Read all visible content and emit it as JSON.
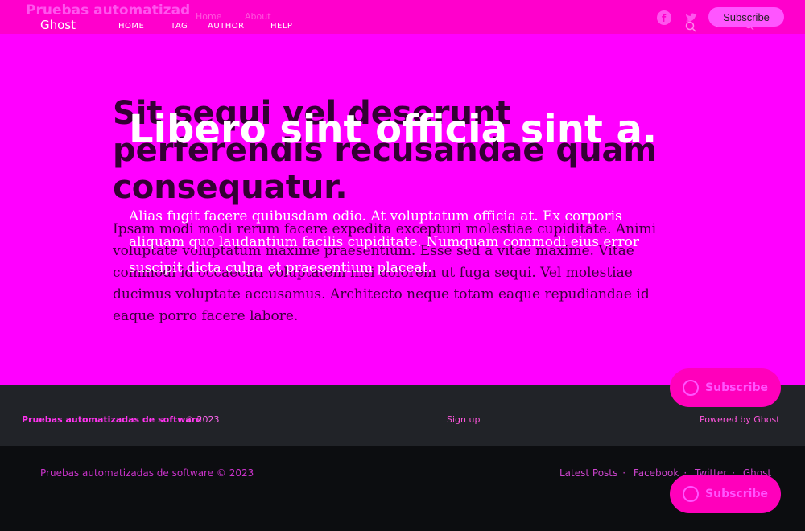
{
  "header": {
    "site_title": "Pruebas automatizad",
    "ghost_logo": "Ghost",
    "nav_overlay": [
      "Home",
      "About"
    ],
    "nav": [
      "HOME",
      "TAG",
      "AUTHOR",
      "HELP"
    ],
    "subscribe_label": "Subscribe",
    "icons": [
      "facebook-icon",
      "twitter-icon",
      "search-icon",
      "rss-icon"
    ]
  },
  "hero": {
    "title_dark": "Sit sequi vel deserunt perferendis recusandae quam consequatur.",
    "title_light": "Libero sint officia sint a.",
    "excerpt_dark": "Ipsam modi modi rerum facere expedita excepturi molestiae cupiditate. Animi voluptate voluptatum maxime praesentium. Esse sed a vitae maxime. Vitae commodi id occaecati voluptatem nisi dolorem ut fuga sequi. Vel molestiae ducimus voluptate accusamus. Architecto neque totam eaque repudiandae id eaque porro facere labore.",
    "excerpt_light": "Alias fugit facere quibusdam odio. At voluptatum officia at. Ex corporis aliquam quo laudantium facilis cupiditate. Numquam commodi eius error suscipit dicta culpa et praesentium placeat."
  },
  "footer_top": {
    "site": "Pruebas automatizadas de software",
    "copyright": "© 2023",
    "signup": "Sign up",
    "powered": "Powered by Ghost"
  },
  "footer_bottom": {
    "copyright": "Pruebas automatizadas de software © 2023",
    "links": [
      "Latest Posts",
      "Facebook",
      "Twitter",
      "Ghost"
    ],
    "separator": "·"
  },
  "portal_label": "Subscribe",
  "colors": {
    "accent": "#ff00ff",
    "topbar": "#ff00cc",
    "footer": "#212328",
    "footer_dark": "#0c0d10"
  }
}
